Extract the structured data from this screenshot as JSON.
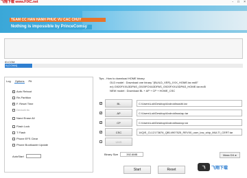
{
  "window": {
    "title": "飞翔下载 www.FIXC.net",
    "buttons": {
      "minimize": "-",
      "maximize": "□",
      "close": "×"
    }
  },
  "banner": {
    "line1": "TEAM CC HAN HANH PHUC VU CAC CHUY",
    "line2": "Nothing is impossible by PrinceComsy"
  },
  "com": {
    "label": "ID:COM",
    "port": "0:[COM4]"
  },
  "tabs": [
    "Log",
    "Options",
    "Pit"
  ],
  "options": [
    {
      "label": "Auto Reboot",
      "checked": true
    },
    {
      "label": "Re-Partition",
      "checked": false
    },
    {
      "label": "F. Reset Time",
      "checked": true
    },
    {
      "label": "DeviceInfo",
      "checked": false
    },
    {
      "label": "Nand Erase All",
      "checked": false
    },
    {
      "label": "Flash Lock",
      "checked": false
    },
    {
      "label": "T Flash",
      "checked": false
    },
    {
      "label": "Phone EFS Clear",
      "checked": false
    },
    {
      "label": "Phone Bootloader Update",
      "checked": false
    }
  ],
  "autostart": {
    "label": "AutoStart",
    "value": ""
  },
  "tips": {
    "title": "Tips - How to download HOME binary",
    "line1": "OLD model : Download one binary    \"(BUILD_VER)_XXX_HOME.tar.md5\"",
    "line2": "ex) G920FXXU3DPAS_G920FOXA3DPAS_G920FXXU3DPAS_HOME.tar.md5",
    "line3": "NEW model : Download BL + AP + CP + HOME_CSC"
  },
  "files": [
    {
      "button": "BL",
      "checked": true,
      "path": "C:\\Users\\Lok\\Desktop\\Android\\sss\\bl.tar"
    },
    {
      "button": "AP",
      "checked": true,
      "path": "C:\\Users\\Lok\\Desktop\\Android\\sss\\ap.tar"
    },
    {
      "button": "CP",
      "checked": true,
      "path": "C:\\Users\\Lok\\Desktop\\Android\\sss\\cp.tar"
    },
    {
      "button": "CSC",
      "checked": true,
      "path": "14QIS_CL12173876_QB14907525_REV00_user_low_ship_MULTI_CERT.tar"
    },
    {
      "button": "UMS",
      "checked": false,
      "path": ""
    }
  ],
  "binary_size": {
    "label": "Binary Size",
    "value": "392.6MB"
  },
  "mass_button": "Mass D/L ▸",
  "bottom_buttons": {
    "start": "Start",
    "reset": "Reset",
    "exit": "Exit"
  },
  "watermark": {
    "logo": "飞",
    "text": "飞翔下载"
  }
}
